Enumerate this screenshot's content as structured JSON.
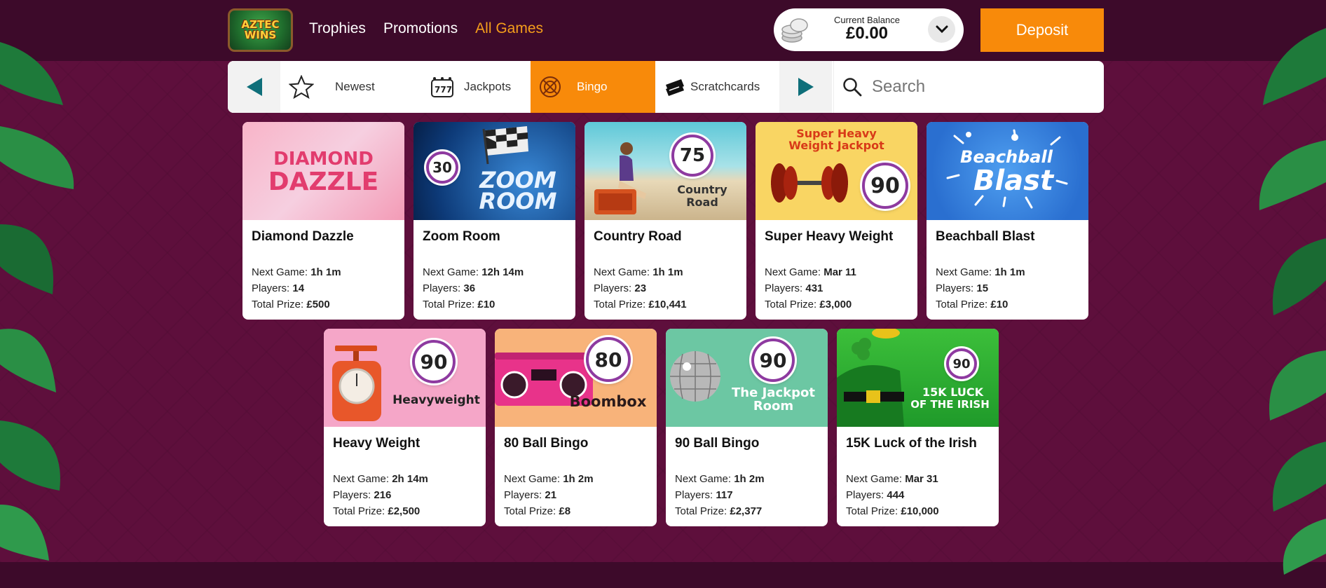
{
  "header": {
    "logo_text": [
      "AZTEC",
      "WINS"
    ],
    "nav": [
      {
        "label": "Trophies",
        "active": false
      },
      {
        "label": "Promotions",
        "active": false
      },
      {
        "label": "All Games",
        "active": true
      }
    ],
    "balance_label": "Current Balance",
    "balance_value": "£0.00",
    "deposit_label": "Deposit"
  },
  "categories": {
    "items": [
      {
        "label": "Newest",
        "icon": "star-icon"
      },
      {
        "label": "Jackpots",
        "icon": "slot-machine-icon"
      },
      {
        "label": "Bingo",
        "icon": "bingo-ball-icon",
        "active": true
      },
      {
        "label": "Scratchcards",
        "icon": "scratchcard-icon"
      }
    ],
    "search_placeholder": "Search"
  },
  "labels": {
    "next_game": "Next Game: ",
    "players": "Players: ",
    "total_prize": "Total Prize: "
  },
  "games": [
    {
      "title": "Diamond Dazzle",
      "next_game": "1h 1m",
      "players": "14",
      "prize": "£500",
      "art": {
        "lines": [
          "DIAMOND",
          "DAZZLE"
        ],
        "ball": ""
      }
    },
    {
      "title": "Zoom Room",
      "next_game": "12h 14m",
      "players": "36",
      "prize": "£10",
      "art": {
        "lines": [
          "ZOOM",
          "ROOM"
        ],
        "ball": "30"
      }
    },
    {
      "title": "Country Road",
      "next_game": "1h 1m",
      "players": "23",
      "prize": "£10,441",
      "art": {
        "lines": [
          "Country",
          "Road"
        ],
        "ball": "75"
      }
    },
    {
      "title": "Super Heavy Weight",
      "next_game": "Mar 11",
      "players": "431",
      "prize": "£3,000",
      "art": {
        "lines": [
          "Super Heavy",
          "Weight Jackpot"
        ],
        "ball": "90"
      }
    },
    {
      "title": "Beachball Blast",
      "next_game": "1h 1m",
      "players": "15",
      "prize": "£10",
      "art": {
        "lines": [
          "Beachball",
          "Blast"
        ],
        "ball": ""
      }
    },
    {
      "title": "Heavy Weight",
      "next_game": "2h 14m",
      "players": "216",
      "prize": "£2,500",
      "art": {
        "lines": [
          "Heavyweight"
        ],
        "ball": "90"
      }
    },
    {
      "title": "80 Ball Bingo",
      "next_game": "1h 2m",
      "players": "21",
      "prize": "£8",
      "art": {
        "lines": [
          "Boombox"
        ],
        "ball": "80"
      }
    },
    {
      "title": "90 Ball Bingo",
      "next_game": "1h 2m",
      "players": "117",
      "prize": "£2,377",
      "art": {
        "lines": [
          "The Jackpot",
          "Room"
        ],
        "ball": "90"
      }
    },
    {
      "title": "15K Luck of the Irish",
      "next_game": "Mar 31",
      "players": "444",
      "prize": "£10,000",
      "art": {
        "lines": [
          "15K LUCK",
          "OF THE IRISH"
        ],
        "ball": "90"
      }
    }
  ]
}
